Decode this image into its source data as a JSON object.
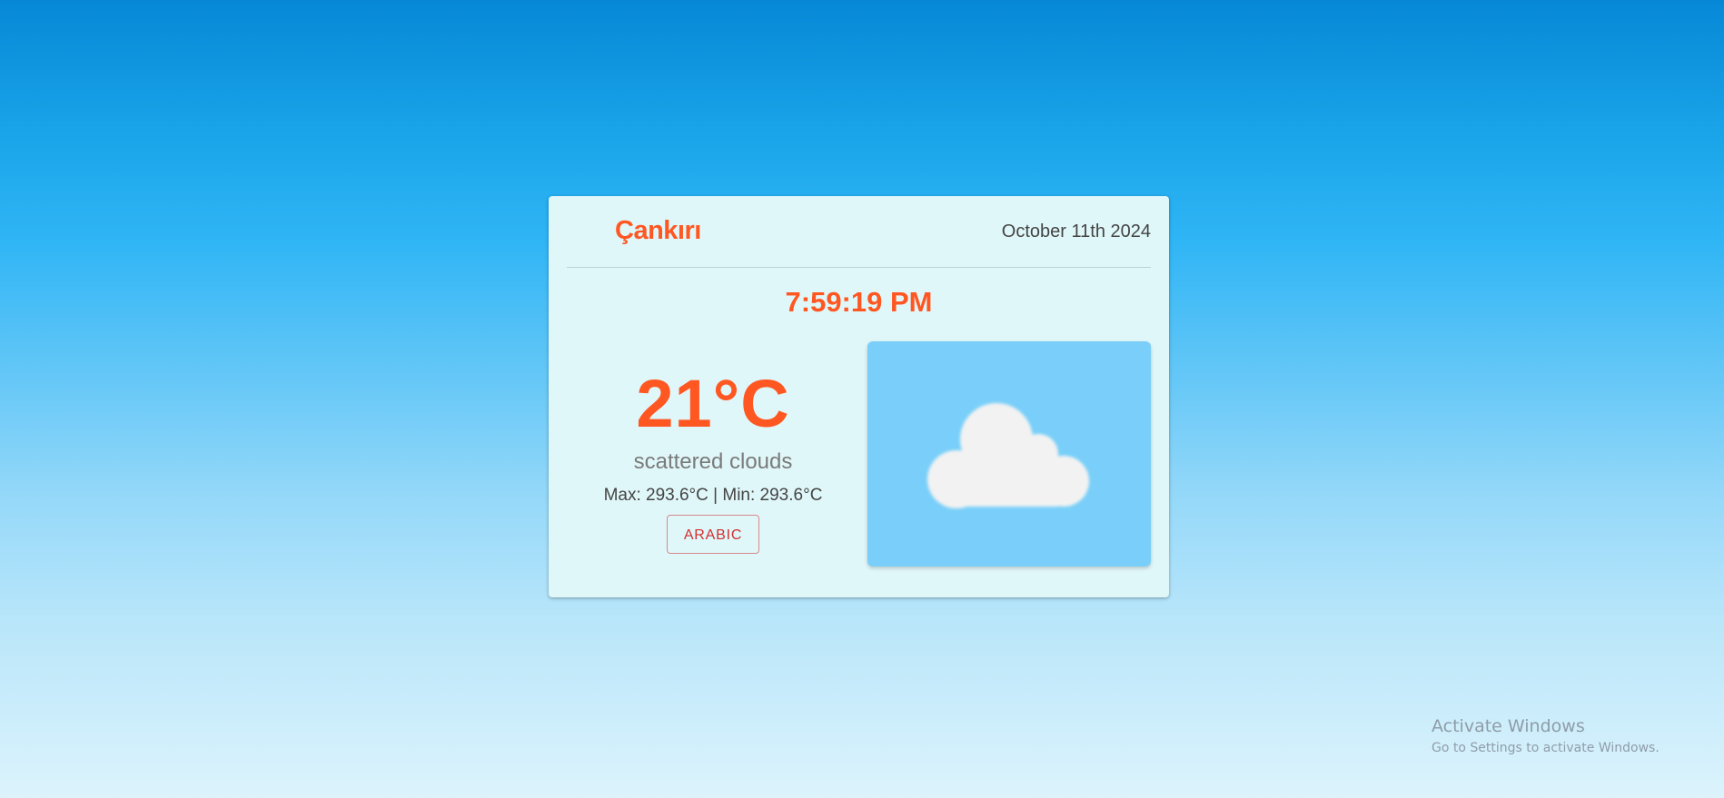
{
  "weather_card": {
    "city": "Çankırı",
    "date": "October 11th 2024",
    "time": "7:59:19 PM",
    "temperature": "21°C",
    "description": "scattered clouds",
    "minmax": "Max: 293.6°C | Min: 293.6°C",
    "language_button_label": "ARABIC",
    "weather_icon": "cloud-icon"
  },
  "watermark": {
    "title": "Activate Windows",
    "subtitle": "Go to Settings to activate Windows."
  },
  "colors": {
    "accent": "#ff5722",
    "card_background": "#e0f7f9",
    "icon_background": "#79cff9",
    "button_text": "#d32f2f"
  }
}
